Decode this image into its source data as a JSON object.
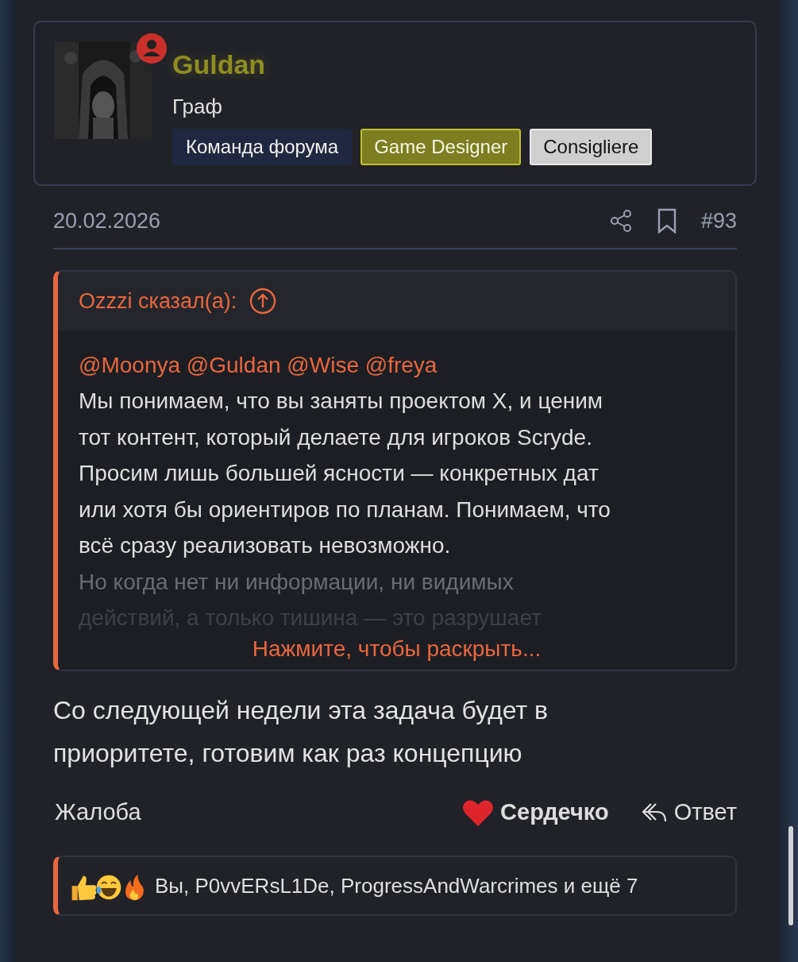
{
  "author": {
    "name": "Guldan",
    "title": "Граф",
    "online": true,
    "badges": [
      {
        "label": "Команда форума",
        "kind": "team"
      },
      {
        "label": "Game Designer",
        "kind": "designer"
      },
      {
        "label": "Consigliere",
        "kind": "rank"
      }
    ]
  },
  "post_meta": {
    "date": "20.02.2026",
    "number": "#93"
  },
  "quote": {
    "author_label": "Ozzzi сказал(а):",
    "mentions": "@Moonya @Guldan @Wise @freya",
    "lines": [
      {
        "text": "Мы понимаем, что вы заняты проектом X, и ценим",
        "faded": false
      },
      {
        "text": "тот контент, который делаете для игроков Scryde.",
        "faded": false
      },
      {
        "text": "Просим лишь большей ясности — конкретных дат",
        "faded": false
      },
      {
        "text": "или хотя бы ориентиров по планам. Понимаем, что",
        "faded": false
      },
      {
        "text": "всё сразу реализовать невозможно.",
        "faded": false
      },
      {
        "text": "Но когда нет ни информации, ни видимых",
        "faded": true
      },
      {
        "text": "действий, а только тишина — это разрушает",
        "faded": true
      }
    ],
    "expand_label": "Нажмите, чтобы раскрыть..."
  },
  "body": "Со следующей недели эта задача будет в приоритете, готовим как раз концепцию",
  "actions": {
    "report": "Жалоба",
    "like": "Сердечко",
    "liked": true,
    "reply": "Ответ"
  },
  "reactions": {
    "text": "Вы, P0vvERsL1De, ProgressAndWarcrimes и ещё 7"
  }
}
